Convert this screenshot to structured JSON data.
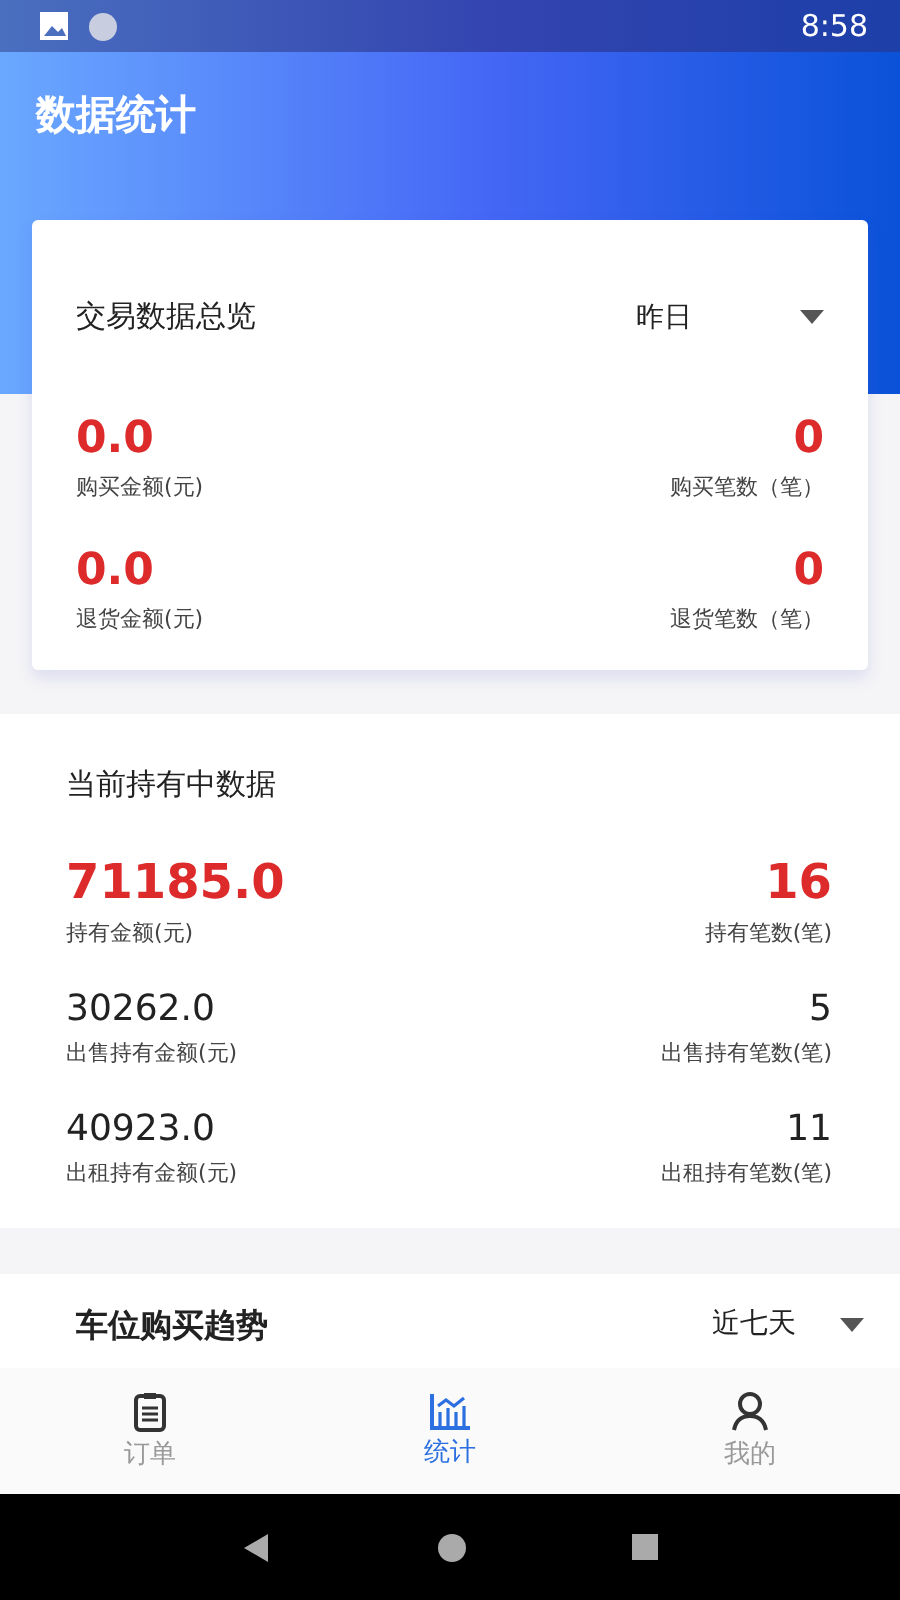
{
  "status_bar": {
    "time": "8:58"
  },
  "header": {
    "title": "数据统计"
  },
  "overview": {
    "title": "交易数据总览",
    "period": "昨日",
    "metrics": [
      {
        "value": "0.0",
        "label": "购买金额(元)",
        "highlight": true
      },
      {
        "value": "0",
        "label": "购买笔数（笔）",
        "highlight": true
      },
      {
        "value": "0.0",
        "label": "退货金额(元)",
        "highlight": true
      },
      {
        "value": "0",
        "label": "退货笔数（笔）",
        "highlight": true
      }
    ]
  },
  "holding": {
    "title": "当前持有中数据",
    "metrics": [
      {
        "value": "71185.0",
        "label": "持有金额(元)",
        "highlight": true
      },
      {
        "value": "16",
        "label": "持有笔数(笔)",
        "highlight": true
      },
      {
        "value": "30262.0",
        "label": "出售持有金额(元)",
        "highlight": false
      },
      {
        "value": "5",
        "label": "出售持有笔数(笔)",
        "highlight": false
      },
      {
        "value": "40923.0",
        "label": "出租持有金额(元)",
        "highlight": false
      },
      {
        "value": "11",
        "label": "出租持有笔数(笔)",
        "highlight": false
      }
    ]
  },
  "trend": {
    "title": "车位购买趋势",
    "period": "近七天"
  },
  "tabs": [
    {
      "label": "订单",
      "kind": "orders",
      "selected": false
    },
    {
      "label": "统计",
      "kind": "stats",
      "selected": true
    },
    {
      "label": "我的",
      "kind": "profile",
      "selected": false
    }
  ]
}
